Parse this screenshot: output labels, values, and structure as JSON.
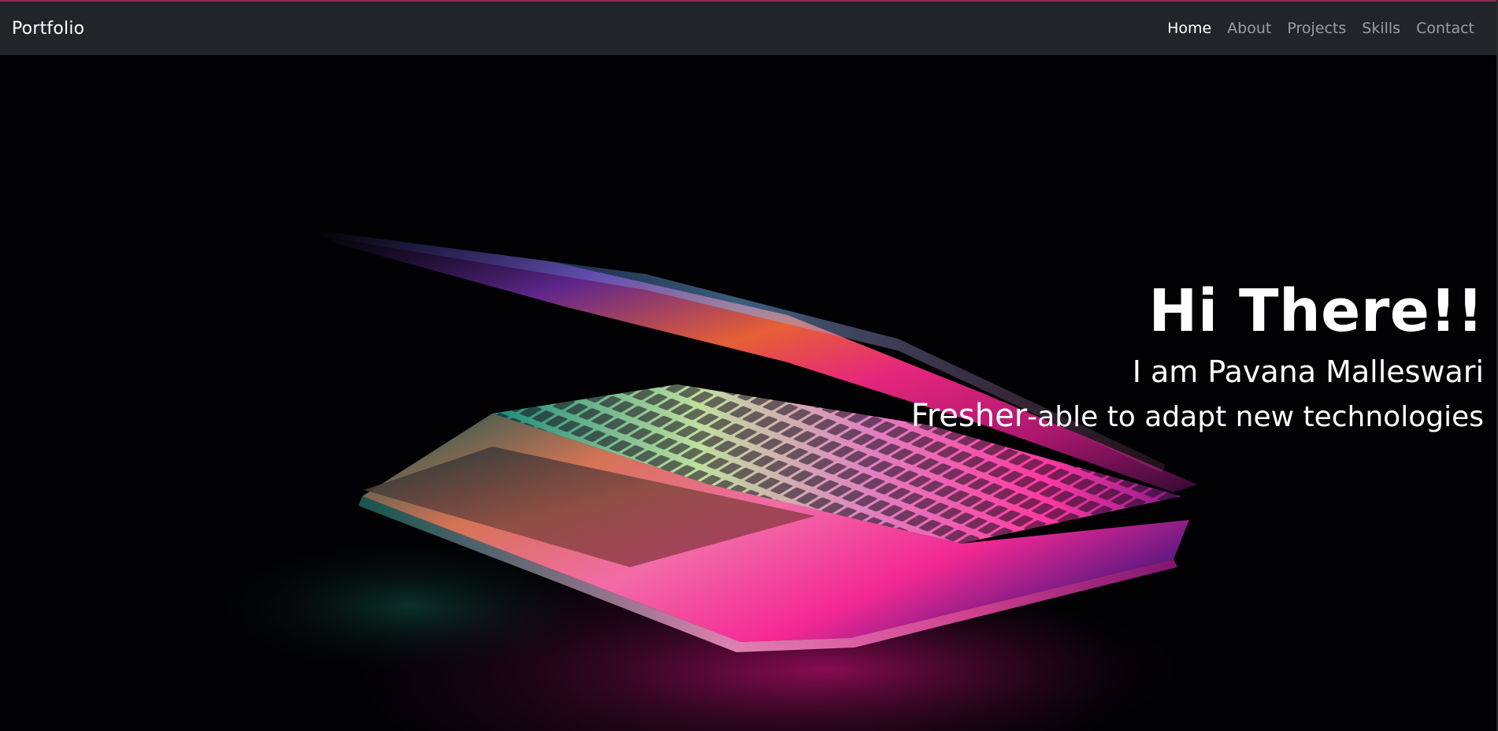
{
  "navbar": {
    "brand": "Portfolio",
    "links": [
      {
        "label": "Home",
        "active": true
      },
      {
        "label": "About",
        "active": false
      },
      {
        "label": "Projects",
        "active": false
      },
      {
        "label": "Skills",
        "active": false
      },
      {
        "label": "Contact",
        "active": false
      }
    ]
  },
  "hero": {
    "title": "Hi There!!",
    "name": "I am Pavana Malleswari",
    "tag_emphasis": "Fresher",
    "tag_rest": "-able to adapt new technologies",
    "background_image": "laptop-with-neon-keyboard-glow"
  },
  "colors": {
    "navbar_bg": "#212529",
    "accent_line": "#8a2c5a",
    "hero_bg": "#020204",
    "text": "#ffffff"
  }
}
